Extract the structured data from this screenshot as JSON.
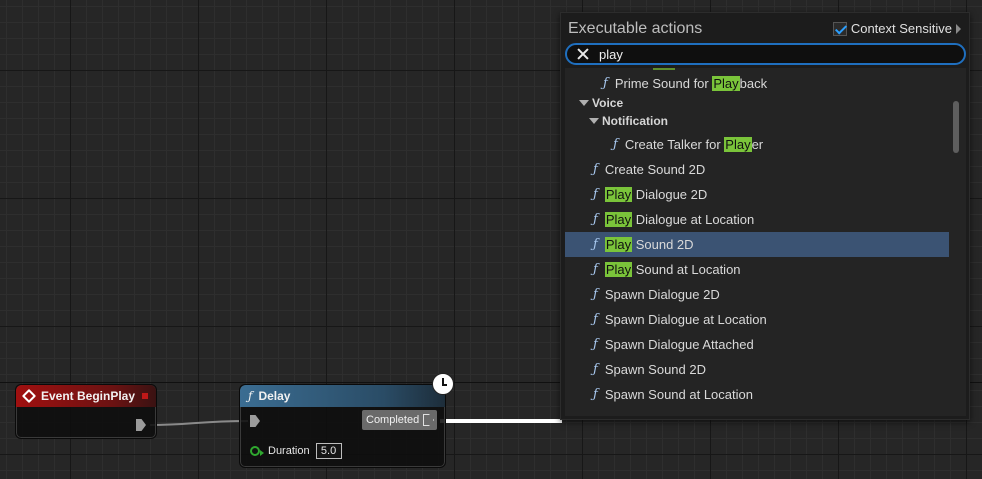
{
  "menu": {
    "title": "Executable actions",
    "context_sensitive_label": "Context Sensitive",
    "context_sensitive_checked": true,
    "search_value": "play",
    "items": [
      {
        "kind": "function",
        "pre": "Prime Sound for ",
        "hl": "Play",
        "post": "back",
        "selected": false
      },
      {
        "kind": "category",
        "label": "Voice"
      },
      {
        "kind": "subcategory",
        "label": "Notification"
      },
      {
        "kind": "function",
        "pre": "Create Talker for ",
        "hl": "Play",
        "post": "er",
        "selected": false
      },
      {
        "kind": "function",
        "pre": "Create Sound 2D",
        "hl": "",
        "post": "",
        "selected": false
      },
      {
        "kind": "function",
        "pre": "",
        "hl": "Play",
        "post": " Dialogue 2D",
        "selected": false
      },
      {
        "kind": "function",
        "pre": "",
        "hl": "Play",
        "post": " Dialogue at Location",
        "selected": false
      },
      {
        "kind": "function",
        "pre": "",
        "hl": "Play",
        "post": " Sound 2D",
        "selected": true
      },
      {
        "kind": "function",
        "pre": "",
        "hl": "Play",
        "post": " Sound at Location",
        "selected": false
      },
      {
        "kind": "function",
        "pre": "Spawn Dialogue 2D",
        "hl": "",
        "post": "",
        "selected": false
      },
      {
        "kind": "function",
        "pre": "Spawn Dialogue at Location",
        "hl": "",
        "post": "",
        "selected": false
      },
      {
        "kind": "function",
        "pre": "Spawn Dialogue Attached",
        "hl": "",
        "post": "",
        "selected": false
      },
      {
        "kind": "function",
        "pre": "Spawn Sound 2D",
        "hl": "",
        "post": "",
        "selected": false
      },
      {
        "kind": "function",
        "pre": "Spawn Sound at Location",
        "hl": "",
        "post": "",
        "selected": false
      }
    ]
  },
  "nodes": {
    "event": {
      "title": "Event BeginPlay"
    },
    "delay": {
      "title": "Delay",
      "output_label": "Completed",
      "input_label": "Duration",
      "input_value": "5.0"
    }
  },
  "colors": {
    "highlight": "#7ac43a",
    "selected_row": "#3b5373",
    "event_header": "#a01010",
    "function_header": "#3b6d92",
    "search_border": "#1f6fbf"
  }
}
